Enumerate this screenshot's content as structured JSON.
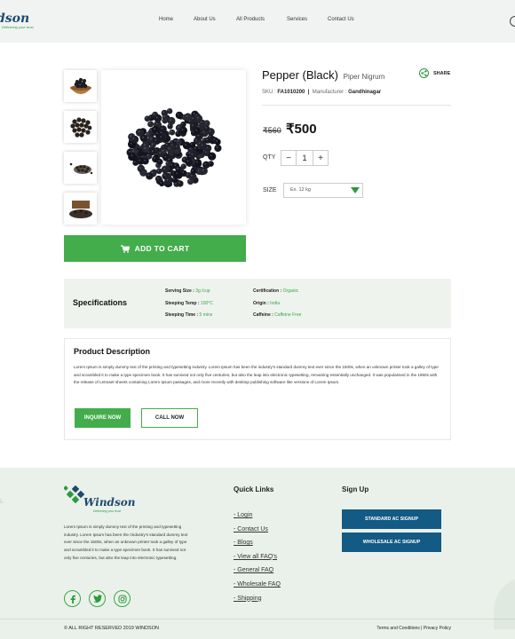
{
  "brand": {
    "name": "Windson",
    "header_logo_text": "dson",
    "tagline": "Delivering your trust",
    "primary_color": "#43ad4b",
    "navy_color": "#135a84"
  },
  "nav": {
    "items": [
      "Home",
      "About Us",
      "All Products",
      "Services",
      "Contact Us"
    ]
  },
  "product": {
    "name": "Pepper (Black)",
    "scientific_name": "Piper Nigrum",
    "share_label": "SHARE",
    "sku_label": "SKU :",
    "sku": "FA1010200",
    "separator": "|",
    "manufacturer_label": "Manufacturer :",
    "manufacturer": "Gandhinagar",
    "old_price": "₹560",
    "price": "₹500",
    "qty_label": "QTY",
    "qty_minus": "−",
    "qty_value": "1",
    "qty_plus": "+",
    "size_label": "SIZE",
    "size_placeholder": "Ex. 12 kg",
    "add_to_cart": "ADD TO CART"
  },
  "specifications": {
    "title": "Specifications",
    "items": [
      {
        "label": "Serving Size :",
        "value": "3g /cup"
      },
      {
        "label": "Steeping Temp :",
        "value": "100°C"
      },
      {
        "label": "Steeping Time :",
        "value": "5 mins"
      },
      {
        "label": "Certification :",
        "value": "Organic"
      },
      {
        "label": "Origin :",
        "value": "India"
      },
      {
        "label": "Caffeine :",
        "value": "Caffeine Free"
      }
    ]
  },
  "description": {
    "title": "Product Description",
    "body": "Lorem Ipsum is simply dummy text of the printing and typesetting industry. Lorem Ipsum has been the industry's standard dummy text ever since the 1500s, when an unknown printer took a galley of type and scrambled it to make a type specimen book. It has survived not only five centuries, but also the leap into electronic typesetting, remaining essentially unchanged. It was popularised in the 1960s with the release of Letraset sheets containing Lorem Ipsum passages, and more recently with desktop publishing software like versions of Lorem Ipsum.",
    "inquire_label": "INQUIRE NOW",
    "call_label": "CALL NOW"
  },
  "footer": {
    "about": "Lorem Ipsum is simply dummy text of the printing and typesetting industry. Lorem Ipsum has been the rindustry's standard dummy text ever since the 1500s, when an unknown printer took a galley of type and scrambled it to make a type specimen book. It has survived not only five centuries, but also the leap into electronic typesetting.",
    "quick_links_title": "Quick Links",
    "quick_links": [
      "- Login",
      "- Contact Us",
      "- Blogs",
      "- View all FAQ's",
      "- General FAQ",
      "- Wholesale FAQ",
      "- Shipping"
    ],
    "signup_title": "Sign Up",
    "standard_signup": "STANDARD AC SIGNUP",
    "wholesale_signup": "WHOLESALE AC SIGNUP",
    "copyright": "© ALL RIGHT RESERVED 2019 WINDSON",
    "terms": "Terms and Conditions",
    "legal_separator": "|",
    "privacy": "Privacy Policy",
    "social_icons": [
      "facebook-icon",
      "twitter-icon",
      "instagram-icon"
    ]
  }
}
